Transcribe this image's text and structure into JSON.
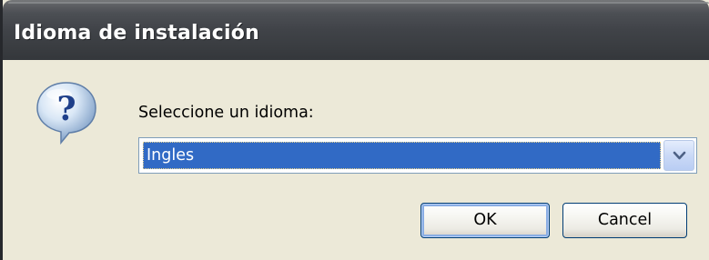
{
  "window": {
    "title": "Idioma de instalación"
  },
  "dialog": {
    "icon": "question-icon",
    "prompt": "Seleccione un idioma:",
    "language_select": {
      "selected": "Ingles"
    },
    "buttons": {
      "ok_label": "OK",
      "cancel_label": "Cancel"
    }
  },
  "colors": {
    "titlebar": "#404348",
    "dialog_background": "#ece9d8",
    "selection_highlight": "#316ac5",
    "button_border": "#003c74"
  }
}
